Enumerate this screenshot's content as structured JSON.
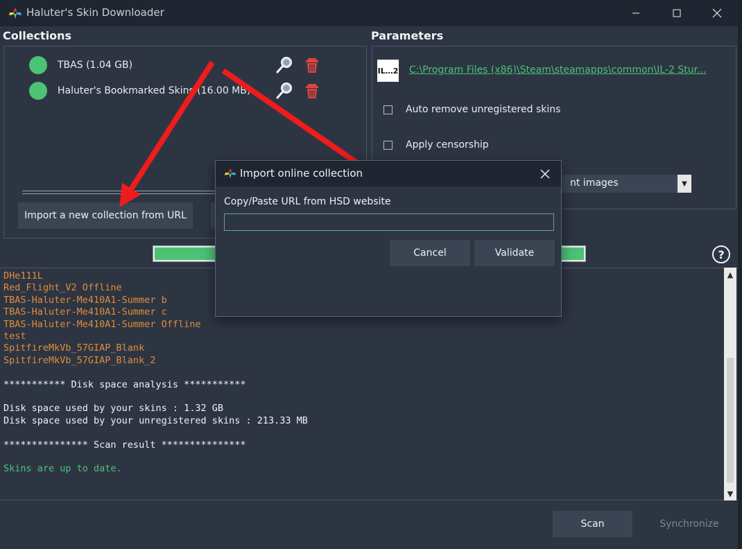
{
  "window": {
    "title": "Haluter's Skin Downloader",
    "minimize_icon": "minimize-icon",
    "maximize_icon": "maximize-icon",
    "close_icon": "close-icon"
  },
  "collections": {
    "heading": "Collections",
    "items": [
      {
        "label": "TBAS (1.04 GB)"
      },
      {
        "label": "Haluter's Bookmarked Skins (16.00 MB)"
      }
    ],
    "import_button": "Import a new collection from URL",
    "status_color": "#4cc275",
    "delete_color": "#e2443f"
  },
  "parameters": {
    "heading": "Parameters",
    "game_logo": "IL…2",
    "game_path": "C:\\Program Files (x86)\\Steam\\steamapps\\common\\IL-2 Stur...",
    "auto_remove_label": "Auto remove unregistered skins",
    "censorship_label": "Apply censorship",
    "combo_value": "nt images"
  },
  "progress": {
    "fraction": 1.0
  },
  "log": {
    "lines": [
      {
        "text": "DHe111L",
        "color": "orange"
      },
      {
        "text": "Red_Flight_V2 Offline",
        "color": "orange"
      },
      {
        "text": "TBAS-Haluter-Me410A1-Summer b",
        "color": "orange"
      },
      {
        "text": "TBAS-Haluter-Me410A1-Summer c",
        "color": "orange"
      },
      {
        "text": "TBAS-Haluter-Me410A1-Summer Offline",
        "color": "orange"
      },
      {
        "text": "test",
        "color": "orange"
      },
      {
        "text": "SpitfireMkVb_57GIAP_Blank",
        "color": "orange"
      },
      {
        "text": "SpitfireMkVb_57GIAP_Blank_2",
        "color": "orange"
      },
      {
        "text": "",
        "color": "white"
      },
      {
        "text": "*********** Disk space analysis ***********",
        "color": "white"
      },
      {
        "text": "",
        "color": "white"
      },
      {
        "text": "Disk space used by your skins : 1.32 GB",
        "color": "white"
      },
      {
        "text": "Disk space used by your unregistered skins : 213.33 MB",
        "color": "white"
      },
      {
        "text": "",
        "color": "white"
      },
      {
        "text": "*************** Scan result ***************",
        "color": "white"
      },
      {
        "text": "",
        "color": "white"
      },
      {
        "text": "Skins are up to date.",
        "color": "green"
      }
    ]
  },
  "footer": {
    "scan_button": "Scan",
    "sync_button": "Synchronize"
  },
  "dialog": {
    "title": "Import online collection",
    "label": "Copy/Paste URL from HSD website",
    "input_value": "",
    "cancel_button": "Cancel",
    "validate_button": "Validate"
  },
  "help_label": "?"
}
